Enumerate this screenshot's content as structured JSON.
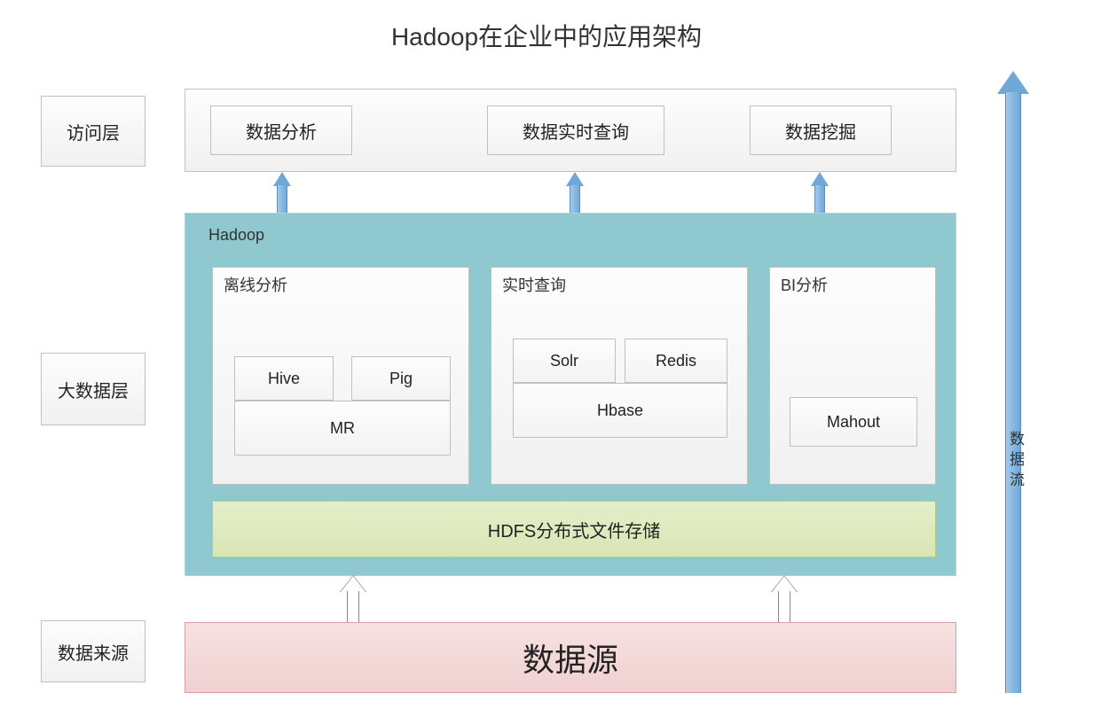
{
  "title": "Hadoop在企业中的应用架构",
  "layers": {
    "access": "访问层",
    "bigdata": "大数据层",
    "source": "数据来源"
  },
  "access_boxes": {
    "analysis": "数据分析",
    "realtime": "数据实时查询",
    "mining": "数据挖掘"
  },
  "hadoop": {
    "label": "Hadoop",
    "groups": {
      "offline": {
        "title": "离线分析",
        "hive": "Hive",
        "pig": "Pig",
        "mr": "MR"
      },
      "realtime": {
        "title": "实时查询",
        "solr": "Solr",
        "redis": "Redis",
        "hbase": "Hbase"
      },
      "bi": {
        "title": "BI分析",
        "mahout": "Mahout"
      }
    },
    "hdfs": "HDFS分布式文件存储"
  },
  "datasource": "数据源",
  "flow_label": "数据流"
}
